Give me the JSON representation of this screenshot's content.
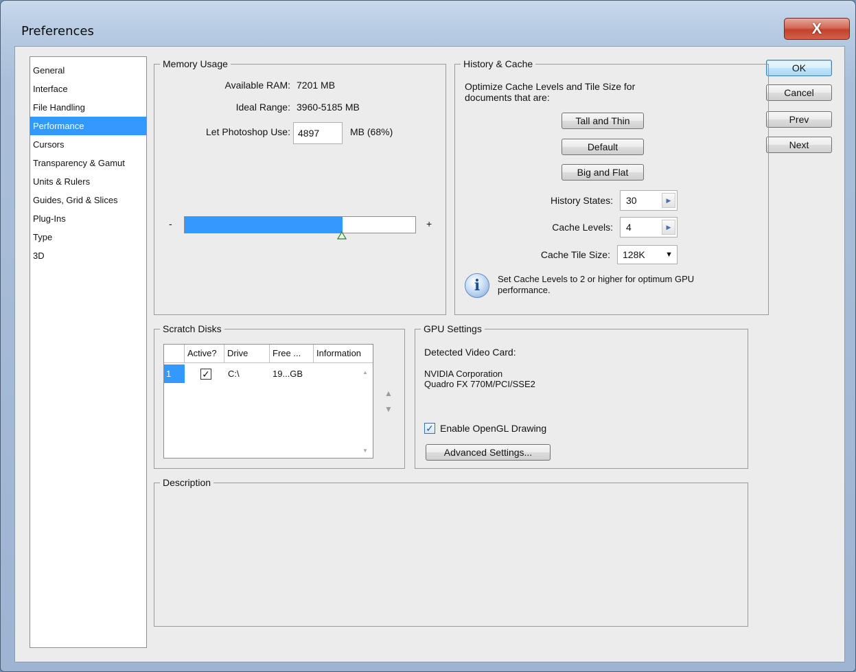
{
  "window": {
    "title": "Preferences",
    "close_glyph": "X"
  },
  "sidebar": {
    "items": [
      {
        "label": "General"
      },
      {
        "label": "Interface"
      },
      {
        "label": "File Handling"
      },
      {
        "label": "Performance",
        "selected": true
      },
      {
        "label": "Cursors"
      },
      {
        "label": "Transparency & Gamut"
      },
      {
        "label": "Units & Rulers"
      },
      {
        "label": "Guides, Grid & Slices"
      },
      {
        "label": "Plug-Ins"
      },
      {
        "label": "Type"
      },
      {
        "label": "3D"
      }
    ]
  },
  "actions": {
    "ok": "OK",
    "cancel": "Cancel",
    "prev": "Prev",
    "next": "Next"
  },
  "memory": {
    "legend": "Memory Usage",
    "available_label": "Available RAM:",
    "available_value": "7201 MB",
    "ideal_label": "Ideal Range:",
    "ideal_value": "3960-5185 MB",
    "use_label": "Let Photoshop Use:",
    "use_value": "4897",
    "use_suffix": "MB (68%)",
    "slider_minus": "-",
    "slider_plus": "+",
    "slider_fraction": 0.68
  },
  "history": {
    "legend": "History & Cache",
    "intro": "Optimize Cache Levels and Tile Size for documents that are:",
    "btn_tall": "Tall and Thin",
    "btn_default": "Default",
    "btn_big": "Big and Flat",
    "states_label": "History States:",
    "states_value": "30",
    "levels_label": "Cache Levels:",
    "levels_value": "4",
    "tile_label": "Cache Tile Size:",
    "tile_value": "128K",
    "info_text": "Set Cache Levels to 2 or higher for optimum GPU performance."
  },
  "scratch": {
    "legend": "Scratch Disks",
    "columns": [
      "",
      "Active?",
      "Drive",
      "Free ...",
      "Information"
    ],
    "rows": [
      {
        "index": "1",
        "active": true,
        "drive": "C:\\",
        "free": "19...GB",
        "info": ""
      }
    ]
  },
  "gpu": {
    "legend": "GPU Settings",
    "detected_label": "Detected Video Card:",
    "vendor": "NVIDIA Corporation",
    "card": "Quadro FX 770M/PCI/SSE2",
    "opengl_label": "Enable OpenGL Drawing",
    "opengl_checked": true,
    "advanced_button": "Advanced Settings..."
  },
  "description": {
    "legend": "Description",
    "text": ""
  },
  "colors": {
    "selection": "#3399ff",
    "slider_fill": "#3399ff"
  }
}
